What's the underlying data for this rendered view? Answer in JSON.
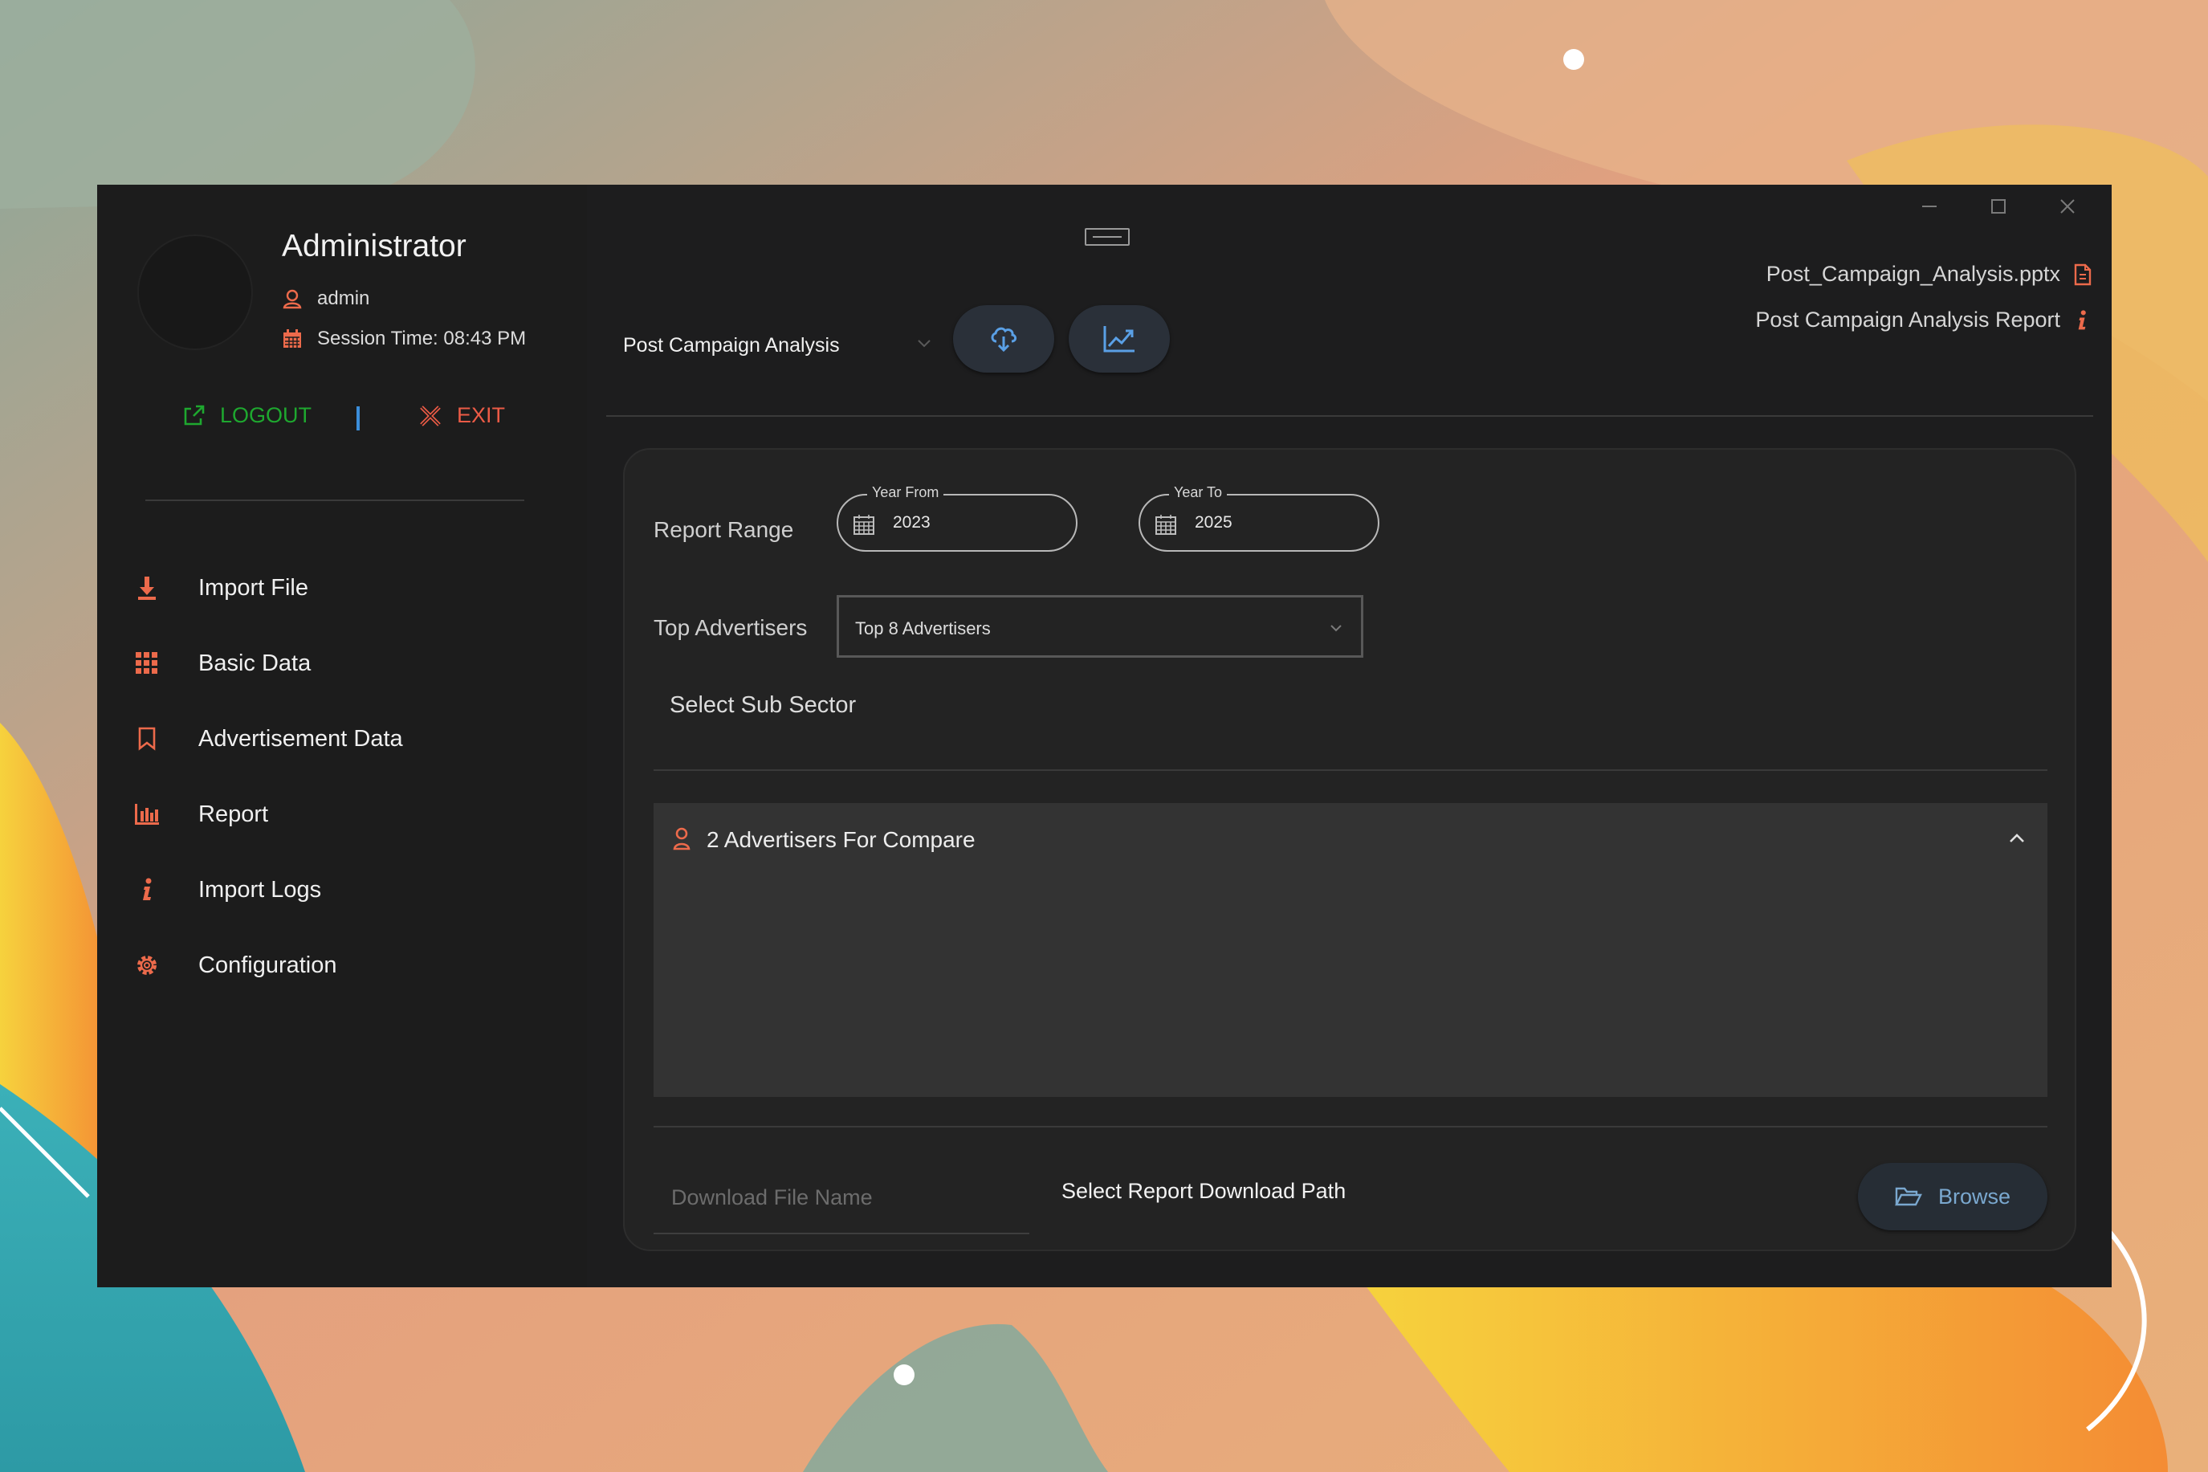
{
  "window": {
    "controls": [
      "minimize",
      "maximize",
      "close"
    ]
  },
  "user": {
    "display_name": "Administrator",
    "username": "admin",
    "session_time": "Session Time: 08:43 PM",
    "logout_label": "LOGOUT",
    "exit_label": "EXIT"
  },
  "sidebar": {
    "items": [
      {
        "label": "Import File",
        "icon": "download-icon"
      },
      {
        "label": "Basic Data",
        "icon": "grid-icon"
      },
      {
        "label": "Advertisement Data",
        "icon": "bookmark-icon"
      },
      {
        "label": "Report",
        "icon": "bar-chart-icon"
      },
      {
        "label": "Import Logs",
        "icon": "info-icon"
      },
      {
        "label": "Configuration",
        "icon": "gear-icon"
      }
    ]
  },
  "toolbar": {
    "report_type": "Post Campaign Analysis",
    "file_name": "Post_Campaign_Analysis.pptx",
    "report_title": "Post Campaign Analysis Report"
  },
  "form": {
    "report_range_label": "Report Range",
    "year_from_label": "Year From",
    "year_from": "2023",
    "year_to_label": "Year To",
    "year_to": "2025",
    "top_advertisers_label": "Top Advertisers",
    "top_advertisers_value": "Top 8 Advertisers",
    "sub_sector_label": "Select Sub Sector",
    "compare_title": "2 Advertisers For Compare",
    "download_placeholder": "Download File Name",
    "download_path_label": "Select Report Download Path",
    "browse_label": "Browse"
  },
  "colors": {
    "accent": "#ec6a4b",
    "logout": "#1ea82f",
    "exit": "#ec5b46",
    "window_bg": "#1d1d1e",
    "card_bg": "#232323",
    "button_icon": "#5aa0e6"
  }
}
